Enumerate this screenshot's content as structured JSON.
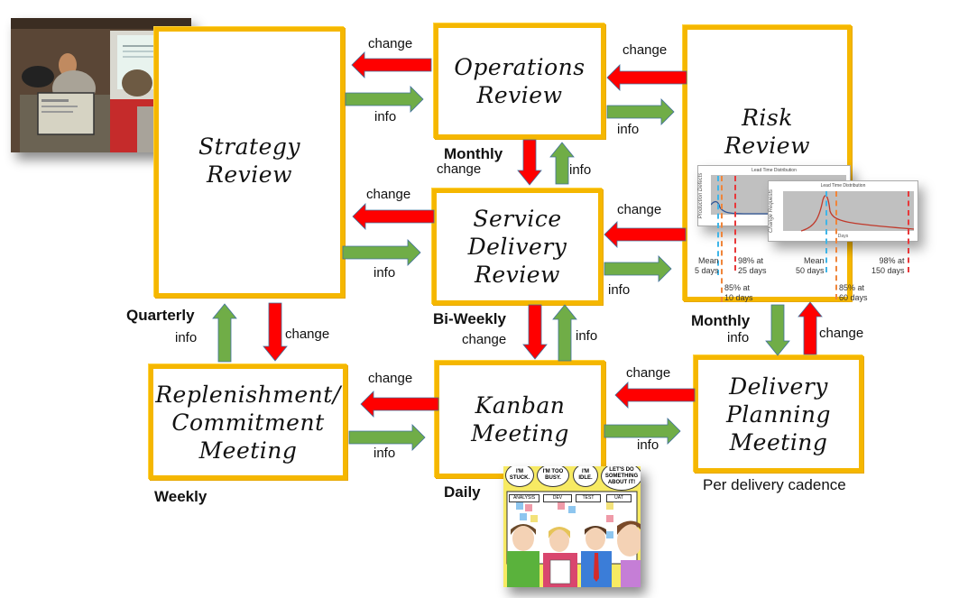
{
  "meetings": {
    "strategy_review": {
      "title": "Strategy\nReview",
      "cadence": "Quarterly"
    },
    "operations_review": {
      "title": "Operations\nReview",
      "cadence": "Monthly"
    },
    "risk_review": {
      "title": "Risk\nReview",
      "cadence": "Monthly"
    },
    "service_delivery_review": {
      "title": "Service\nDelivery\nReview",
      "cadence": "Bi-Weekly"
    },
    "replenishment_meeting": {
      "title": "Replenishment/\nCommitment\nMeeting",
      "cadence": "Weekly"
    },
    "kanban_meeting": {
      "title": "Kanban\nMeeting",
      "cadence": "Daily"
    },
    "delivery_planning_meeting": {
      "title": "Delivery\nPlanning\nMeeting",
      "cadence": "Per delivery cadence"
    }
  },
  "flow_labels": {
    "change": "change",
    "info": "info"
  },
  "colors": {
    "box_border": "#f5b700",
    "change_arrow": "#ff0000",
    "info_arrow": "#70ad47",
    "arrow_outline": "#41719c"
  },
  "risk_charts": {
    "chart1": {
      "title": "Lead Time Distribution",
      "ylabel": "Production Defects",
      "annotations": [
        {
          "text": "Mean\n5 days",
          "color": "#3fb5e8"
        },
        {
          "text": "85% at\n10 days",
          "color": "#f0853a"
        },
        {
          "text": "98% at\n25 days",
          "color": "#e8383a"
        }
      ]
    },
    "chart2": {
      "title": "Lead Time Distribution",
      "ylabel": "Change Requests",
      "xlabel": "Days",
      "annotations": [
        {
          "text": "Mean\n50 days",
          "color": "#3fb5e8"
        },
        {
          "text": "85% at\n60 days",
          "color": "#f0853a"
        },
        {
          "text": "98% at\n150 days",
          "color": "#e8383a"
        }
      ]
    }
  },
  "comic": {
    "bubbles": [
      "I'M\nSTUCK.",
      "I'M TOO\nBUSY.",
      "I'M\nIDLE.",
      "LET'S DO\nSOMETHING\nABOUT IT!"
    ],
    "columns": [
      "ANALYSIS",
      "DEV",
      "TEST",
      "UAT"
    ]
  }
}
